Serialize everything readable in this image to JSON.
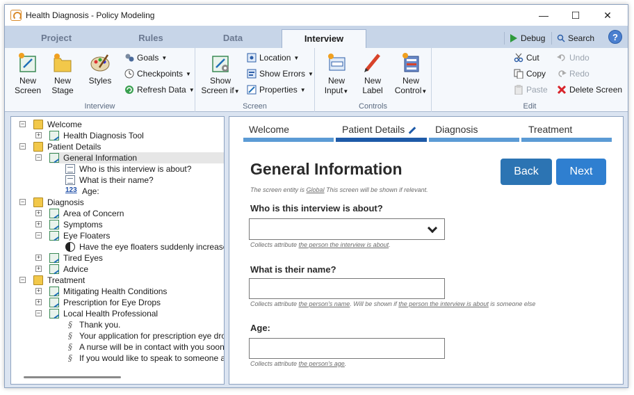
{
  "window": {
    "title": "Health Diagnosis - Policy Modeling"
  },
  "tabs": [
    "Project",
    "Rules",
    "Data",
    "Interview"
  ],
  "toolbar_right": {
    "debug": "Debug",
    "search": "Search",
    "help": "?"
  },
  "ribbon": {
    "interview": {
      "label": "Interview",
      "new_screen": [
        "New",
        "Screen"
      ],
      "new_stage": [
        "New",
        "Stage"
      ],
      "styles": "Styles",
      "goals": "Goals",
      "checkpoints": "Checkpoints",
      "refresh_data": "Refresh Data"
    },
    "screen": {
      "label": "Screen",
      "show_screen_if": [
        "Show",
        "Screen if"
      ],
      "location": "Location",
      "show_errors": "Show Errors",
      "properties": "Properties"
    },
    "controls": {
      "label": "Controls",
      "new_input": [
        "New",
        "Input"
      ],
      "new_label": [
        "New",
        "Label"
      ],
      "new_control": [
        "New",
        "Control"
      ]
    },
    "edit": {
      "label": "Edit",
      "cut": "Cut",
      "copy": "Copy",
      "paste": "Paste",
      "undo": "Undo",
      "redo": "Redo",
      "delete_screen": "Delete Screen"
    }
  },
  "tree": [
    {
      "label": "Welcome",
      "depth": 0,
      "icon": "folder-icon",
      "toggle": "-"
    },
    {
      "label": "Health Diagnosis Tool",
      "depth": 1,
      "icon": "screen-icon",
      "toggle": "+"
    },
    {
      "label": "Patient Details",
      "depth": 0,
      "icon": "folder-icon",
      "toggle": "-"
    },
    {
      "label": "General Information",
      "depth": 1,
      "icon": "screen-icon",
      "toggle": "-",
      "selected": true
    },
    {
      "label": "Who is this interview is about?",
      "depth": 2,
      "icon": "input-icon",
      "toggle": ""
    },
    {
      "label": "What is their name?",
      "depth": 2,
      "icon": "input-icon",
      "toggle": ""
    },
    {
      "label": "Age:",
      "depth": 2,
      "icon": "number-icon",
      "toggle": ""
    },
    {
      "label": "Diagnosis",
      "depth": 0,
      "icon": "folder-icon",
      "toggle": "-"
    },
    {
      "label": "Area of Concern",
      "depth": 1,
      "icon": "screen-icon",
      "toggle": "+"
    },
    {
      "label": "Symptoms",
      "depth": 1,
      "icon": "screen-icon",
      "toggle": "+"
    },
    {
      "label": "Eye Floaters",
      "depth": 1,
      "icon": "screen-icon",
      "toggle": "-"
    },
    {
      "label": "Have the eye floaters suddenly increased?",
      "depth": 2,
      "icon": "boolean-icon",
      "toggle": ""
    },
    {
      "label": "Tired Eyes",
      "depth": 1,
      "icon": "screen-icon",
      "toggle": "+"
    },
    {
      "label": "Advice",
      "depth": 1,
      "icon": "screen-icon",
      "toggle": "+"
    },
    {
      "label": "Treatment",
      "depth": 0,
      "icon": "folder-icon",
      "toggle": "-"
    },
    {
      "label": "Mitigating Health Conditions",
      "depth": 1,
      "icon": "screen-icon",
      "toggle": "+"
    },
    {
      "label": "Prescription for Eye Drops",
      "depth": 1,
      "icon": "screen-icon",
      "toggle": "+"
    },
    {
      "label": "Local Health Professional",
      "depth": 1,
      "icon": "screen-icon",
      "toggle": "-"
    },
    {
      "label": "Thank you.",
      "depth": 2,
      "icon": "label-icon",
      "toggle": ""
    },
    {
      "label": "Your application for prescription eye drops ha",
      "depth": 2,
      "icon": "label-icon",
      "toggle": ""
    },
    {
      "label": "A nurse will be in contact with you soon.",
      "depth": 2,
      "icon": "label-icon",
      "toggle": ""
    },
    {
      "label": "If you would like to speak to someone about",
      "depth": 2,
      "icon": "label-icon",
      "toggle": ""
    }
  ],
  "stages": [
    "Welcome",
    "Patient Details",
    "Diagnosis",
    "Treatment"
  ],
  "active_stage": "Patient Details",
  "screen": {
    "title": "General Information",
    "back": "Back",
    "next": "Next",
    "entity_note_pre": "The screen entity is ",
    "entity_note_link": "Global",
    "entity_note_post": "  This screen will be shown if relevant.",
    "q1_label": "Who is this interview is about?",
    "q1_note_pre": "Collects attribute ",
    "q1_note_link": "the person the interview is about",
    "q1_note_post": ".",
    "q2_label": "What is their name?",
    "q2_note_pre": "Collects attribute ",
    "q2_note_link": "the person's name",
    "q2_note_mid": ".  Will be shown if ",
    "q2_note_link2": "the person the interview is about",
    "q2_note_post": " is someone else",
    "q3_label": "Age:",
    "q3_note_pre": "Collects attribute ",
    "q3_note_link": "the person's age",
    "q3_note_post": "."
  },
  "colors": {
    "accent": "#1e5aa8",
    "stage_bar": "#5b9bd5",
    "back_button": "#2c74b3",
    "next_button": "#2f7fd0"
  }
}
